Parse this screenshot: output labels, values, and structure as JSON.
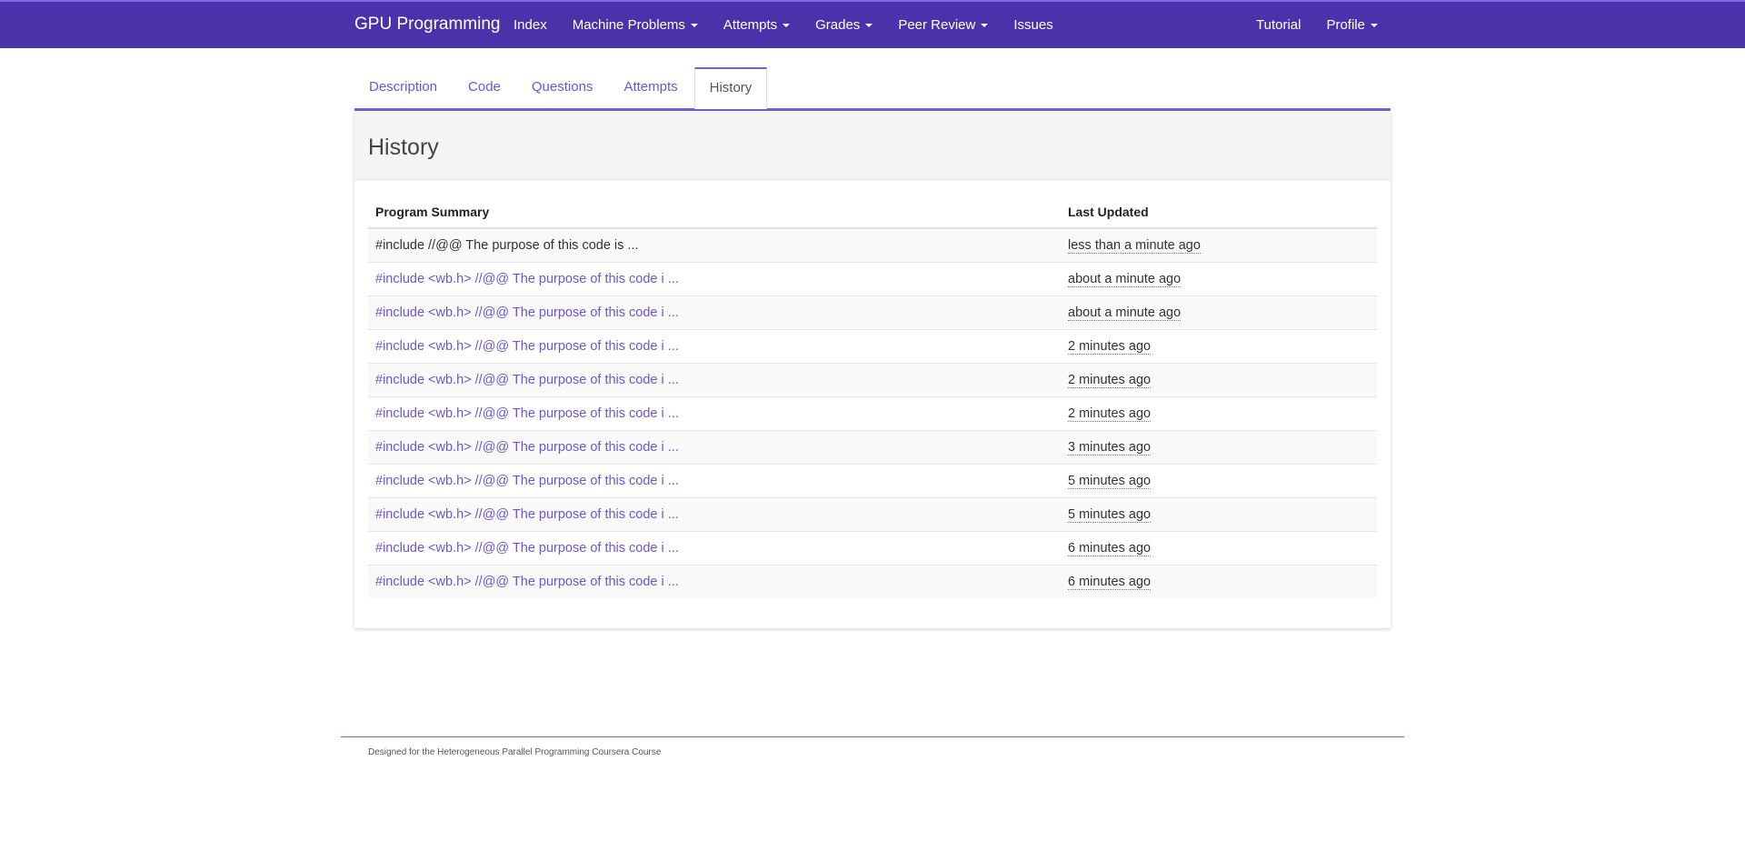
{
  "navbar": {
    "brand": "GPU Programming",
    "left_items": [
      {
        "label": "Index",
        "dropdown": false
      },
      {
        "label": "Machine Problems",
        "dropdown": true
      },
      {
        "label": "Attempts",
        "dropdown": true
      },
      {
        "label": "Grades",
        "dropdown": true
      },
      {
        "label": "Peer Review",
        "dropdown": true
      },
      {
        "label": "Issues",
        "dropdown": false
      }
    ],
    "right_items": [
      {
        "label": "Tutorial",
        "dropdown": false
      },
      {
        "label": "Profile",
        "dropdown": true
      }
    ]
  },
  "tabs": [
    {
      "label": "Description",
      "active": false
    },
    {
      "label": "Code",
      "active": false
    },
    {
      "label": "Questions",
      "active": false
    },
    {
      "label": "Attempts",
      "active": false
    },
    {
      "label": "History",
      "active": true
    }
  ],
  "panel": {
    "title": "History",
    "columns": [
      "Program Summary",
      "Last Updated"
    ],
    "rows": [
      {
        "summary": "#include //@@ The purpose of this code is ...",
        "updated": "less than a minute ago",
        "link": false
      },
      {
        "summary": "#include <wb.h> //@@ The purpose of this code i ...",
        "updated": "about a minute ago",
        "link": true
      },
      {
        "summary": "#include <wb.h> //@@ The purpose of this code i ...",
        "updated": "about a minute ago",
        "link": true
      },
      {
        "summary": "#include <wb.h> //@@ The purpose of this code i ...",
        "updated": "2 minutes ago",
        "link": true
      },
      {
        "summary": "#include <wb.h> //@@ The purpose of this code i ...",
        "updated": "2 minutes ago",
        "link": true
      },
      {
        "summary": "#include <wb.h> //@@ The purpose of this code i ...",
        "updated": "2 minutes ago",
        "link": true
      },
      {
        "summary": "#include <wb.h> //@@ The purpose of this code i ...",
        "updated": "3 minutes ago",
        "link": true
      },
      {
        "summary": "#include <wb.h> //@@ The purpose of this code i ...",
        "updated": "5 minutes ago",
        "link": true
      },
      {
        "summary": "#include <wb.h> //@@ The purpose of this code i ...",
        "updated": "5 minutes ago",
        "link": true
      },
      {
        "summary": "#include <wb.h> //@@ The purpose of this code i ...",
        "updated": "6 minutes ago",
        "link": true
      },
      {
        "summary": "#include <wb.h> //@@ The purpose of this code i ...",
        "updated": "6 minutes ago",
        "link": true
      }
    ]
  },
  "footer": {
    "text": "Designed for the Heterogeneous Parallel Programming Coursera Course"
  },
  "colors": {
    "navbar": "#4b32aa",
    "accent": "#6f55cf",
    "tab_border": "#7a5ed6"
  }
}
